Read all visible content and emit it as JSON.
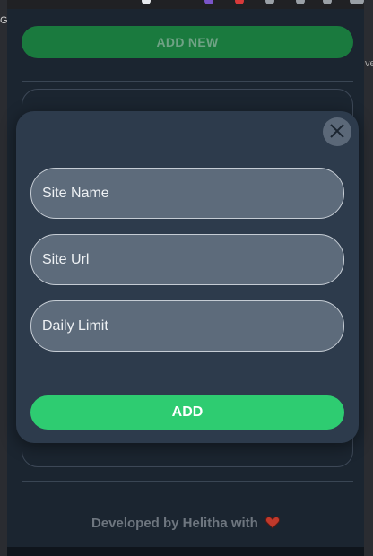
{
  "browser": {
    "left_fragment": "Go",
    "right_fragment": "ve"
  },
  "popup": {
    "add_new_label": "ADD NEW",
    "footer": {
      "text": "Developed by Helitha with",
      "heart_icon": "heart-icon"
    }
  },
  "modal": {
    "close_icon": "close-icon",
    "fields": {
      "site_name_placeholder": "Site Name",
      "site_url_placeholder": "Site Url",
      "daily_limit_placeholder": "Daily Limit"
    },
    "add_label": "ADD"
  },
  "colors": {
    "background": "#1b2530",
    "modal": "#2d3b4c",
    "field": "#5d6b7b",
    "accent_green": "#2ecc71",
    "dim_green": "#1a7a3e",
    "heart": "#c0392b"
  }
}
